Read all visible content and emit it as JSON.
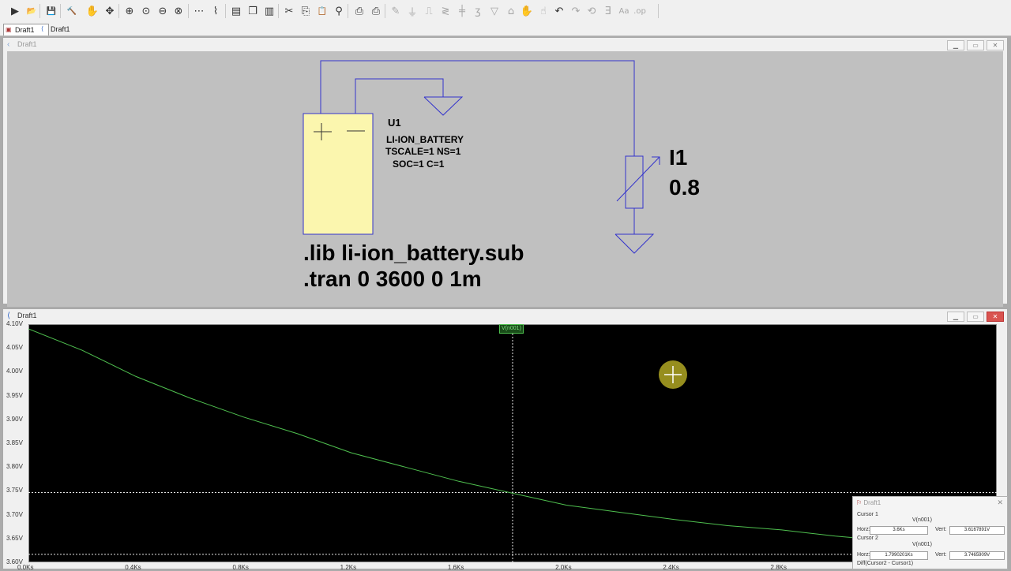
{
  "toolbar": {
    "buttons": [
      {
        "name": "run-icon",
        "glyph": "▶",
        "dim": false
      },
      {
        "name": "open-folder-icon",
        "glyph": "📂",
        "dim": false
      },
      {
        "name": "save-icon",
        "glyph": "💾",
        "dim": false
      },
      {
        "name": "control-panel-icon",
        "glyph": "🔨",
        "dim": false
      },
      {
        "name": "halt-icon",
        "glyph": "✋",
        "dim": false
      },
      {
        "name": "pan-icon",
        "glyph": "✥",
        "dim": false
      },
      {
        "name": "zoom-in-icon",
        "glyph": "⊕",
        "dim": false
      },
      {
        "name": "zoom-fit-icon",
        "glyph": "⊙",
        "dim": false
      },
      {
        "name": "zoom-out-icon",
        "glyph": "⊖",
        "dim": false
      },
      {
        "name": "zoom-cancel-icon",
        "glyph": "⊗",
        "dim": false
      },
      {
        "name": "autorange-icon",
        "glyph": "⋯",
        "dim": false
      },
      {
        "name": "fft-icon",
        "glyph": "⌇",
        "dim": false
      },
      {
        "name": "tile-horizontal-icon",
        "glyph": "▤",
        "dim": false
      },
      {
        "name": "cascade-icon",
        "glyph": "❐",
        "dim": false
      },
      {
        "name": "tile-vertical-icon",
        "glyph": "▥",
        "dim": false
      },
      {
        "name": "cut-icon",
        "glyph": "✂",
        "dim": false
      },
      {
        "name": "copy-icon",
        "glyph": "⎘",
        "dim": false
      },
      {
        "name": "paste-icon",
        "glyph": "📋",
        "dim": false
      },
      {
        "name": "find-icon",
        "glyph": "⚲",
        "dim": false
      },
      {
        "name": "print-setup-icon",
        "glyph": "⎙",
        "dim": false
      },
      {
        "name": "print-icon",
        "glyph": "⎙",
        "dim": false
      },
      {
        "name": "wire-icon",
        "glyph": "✎",
        "dim": true
      },
      {
        "name": "ground-icon",
        "glyph": "⏚",
        "dim": true
      },
      {
        "name": "label-net-icon",
        "glyph": "⎍",
        "dim": true
      },
      {
        "name": "resistor-icon",
        "glyph": "≷",
        "dim": true
      },
      {
        "name": "capacitor-icon",
        "glyph": "╪",
        "dim": true
      },
      {
        "name": "inductor-icon",
        "glyph": "ʒ",
        "dim": true
      },
      {
        "name": "diode-icon",
        "glyph": "▽",
        "dim": true
      },
      {
        "name": "component-icon",
        "glyph": "⌂",
        "dim": true
      },
      {
        "name": "move-icon",
        "glyph": "✋",
        "dim": true
      },
      {
        "name": "drag-icon",
        "glyph": "☝",
        "dim": true
      },
      {
        "name": "undo-icon",
        "glyph": "↶",
        "dim": false
      },
      {
        "name": "redo-icon",
        "glyph": "↷",
        "dim": true
      },
      {
        "name": "rotate-icon",
        "glyph": "⟲",
        "dim": true
      },
      {
        "name": "mirror-icon",
        "glyph": "Ǝ",
        "dim": true
      },
      {
        "name": "text-icon",
        "glyph": "Aa",
        "dim": true
      },
      {
        "name": "spice-directive-icon",
        "glyph": ".op",
        "dim": true
      }
    ]
  },
  "tabs": [
    {
      "label": "Draft1",
      "kind": "schematic"
    },
    {
      "label": "Draft1",
      "kind": "plot"
    }
  ],
  "schematic_window": {
    "title": "Draft1",
    "component": {
      "ref": "U1",
      "model": "LI-ION_BATTERY",
      "params_line1": "TSCALE=1 NS=1",
      "params_line2": "SOC=1 C=1",
      "plus": "+",
      "minus": "—"
    },
    "source": {
      "ref": "I1",
      "value": "0.8"
    },
    "directives": [
      ".lib li-ion_battery.sub",
      ".tran 0 3600 0 1m"
    ],
    "colors": {
      "wire": "#3333cc",
      "battery_fill": "#fbf6ae",
      "background": "#c0c0c0"
    }
  },
  "plot_window": {
    "title": "Draft1",
    "trace_label": "V(n001)",
    "colors": {
      "trace": "#4fc04f",
      "background": "#000000",
      "grid": "#9a9a9a"
    }
  },
  "chart_data": {
    "type": "line",
    "title": "",
    "xlabel": "",
    "ylabel": "",
    "series": [
      {
        "name": "V(n001)",
        "x": [
          0,
          200,
          400,
          600,
          800,
          1000,
          1200,
          1400,
          1600,
          1800,
          2000,
          2200,
          2400,
          2600,
          2800,
          3000,
          3200,
          3400,
          3600
        ],
        "y": [
          4.09,
          4.045,
          3.99,
          3.945,
          3.905,
          3.87,
          3.83,
          3.8,
          3.77,
          3.745,
          3.72,
          3.705,
          3.69,
          3.677,
          3.668,
          3.655,
          3.645,
          3.64,
          3.635
        ]
      }
    ],
    "x_ticks": [
      "0.0Ks",
      "0.4Ks",
      "0.8Ks",
      "1.2Ks",
      "1.6Ks",
      "2.0Ks",
      "2.4Ks",
      "2.8Ks"
    ],
    "x_tick_values": [
      0,
      400,
      800,
      1200,
      1600,
      2000,
      2400,
      2800
    ],
    "y_ticks": [
      "3.60V",
      "3.65V",
      "3.70V",
      "3.75V",
      "3.80V",
      "3.85V",
      "3.90V",
      "3.95V",
      "4.00V",
      "4.05V",
      "4.10V"
    ],
    "y_tick_values": [
      3.6,
      3.65,
      3.7,
      3.75,
      3.8,
      3.85,
      3.9,
      3.95,
      4.0,
      4.05,
      4.1
    ],
    "xlim": [
      0,
      3600
    ],
    "ylim": [
      3.6,
      4.1
    ],
    "cursor": {
      "x": 1800,
      "y": 3.7466
    }
  },
  "cursor_dialog": {
    "title": "Draft1",
    "cursor1_label": "Cursor 1",
    "cursor1_trace": "V(n001)",
    "cursor1_horz_label": "Horz:",
    "cursor1_horz": "3.6Ks",
    "cursor1_vert_label": "Vert:",
    "cursor1_vert": "3.6167891V",
    "cursor2_label": "Cursor 2",
    "cursor2_trace": "V(n001)",
    "cursor2_horz_label": "Horz:",
    "cursor2_horz": "1.7990201Ks",
    "cursor2_vert_label": "Vert:",
    "cursor2_vert": "3.7465909V",
    "diff_label": "Diff(Cursor2 - Cursor1)"
  }
}
